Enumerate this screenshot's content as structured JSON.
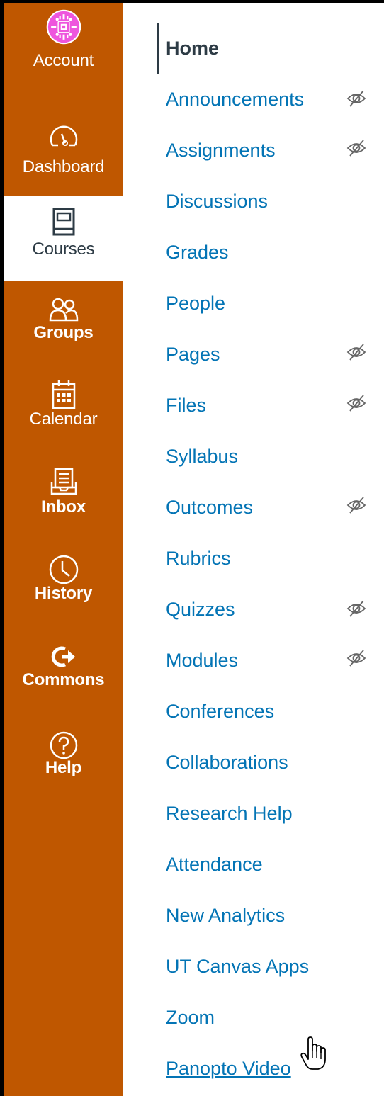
{
  "global_nav": {
    "background": "#bf5700",
    "items": [
      {
        "label": "Account",
        "icon": "avatar-icon"
      },
      {
        "label": "Dashboard",
        "icon": "speedometer-icon"
      },
      {
        "label": "Courses",
        "icon": "book-icon",
        "active": true
      },
      {
        "label": "Groups",
        "icon": "groups-icon"
      },
      {
        "label": "Calendar",
        "icon": "calendar-icon"
      },
      {
        "label": "Inbox",
        "icon": "inbox-icon"
      },
      {
        "label": "History",
        "icon": "clock-icon"
      },
      {
        "label": "Commons",
        "icon": "commons-arrow-icon"
      },
      {
        "label": "Help",
        "icon": "help-icon"
      }
    ]
  },
  "course_nav": {
    "link_color": "#0374b5",
    "items": [
      {
        "label": "Home",
        "active": true
      },
      {
        "label": "Announcements",
        "hidden": true
      },
      {
        "label": "Assignments",
        "hidden": true
      },
      {
        "label": "Discussions"
      },
      {
        "label": "Grades"
      },
      {
        "label": "People"
      },
      {
        "label": "Pages",
        "hidden": true
      },
      {
        "label": "Files",
        "hidden": true
      },
      {
        "label": "Syllabus"
      },
      {
        "label": "Outcomes",
        "hidden": true
      },
      {
        "label": "Rubrics"
      },
      {
        "label": "Quizzes",
        "hidden": true
      },
      {
        "label": "Modules",
        "hidden": true
      },
      {
        "label": "Conferences"
      },
      {
        "label": "Collaborations"
      },
      {
        "label": "Research Help"
      },
      {
        "label": "Attendance"
      },
      {
        "label": "New Analytics"
      },
      {
        "label": "UT Canvas Apps"
      },
      {
        "label": "Zoom"
      },
      {
        "label": "Panopto Video",
        "hovered": true
      }
    ]
  }
}
